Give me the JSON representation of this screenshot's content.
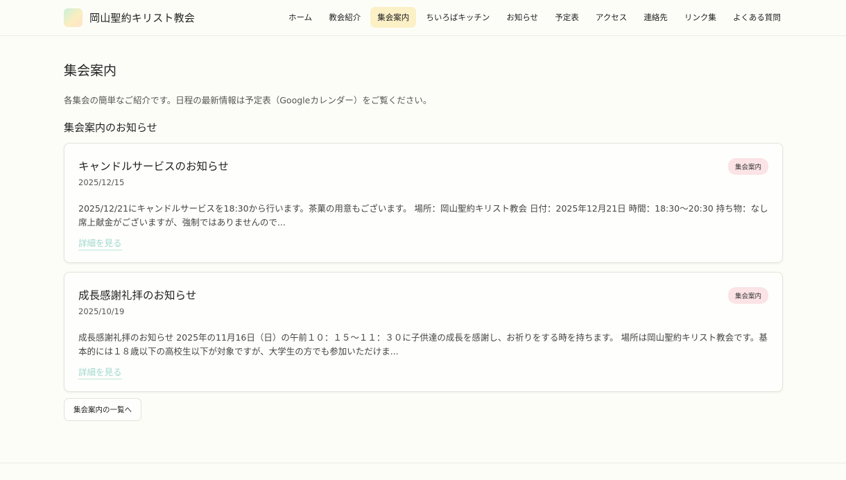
{
  "site": {
    "name": "岡山聖約キリスト教会"
  },
  "nav": {
    "items": [
      {
        "label": "ホーム",
        "active": false
      },
      {
        "label": "教会紹介",
        "active": false
      },
      {
        "label": "集会案内",
        "active": true
      },
      {
        "label": "ちいろばキッチン",
        "active": false
      },
      {
        "label": "お知らせ",
        "active": false
      },
      {
        "label": "予定表",
        "active": false
      },
      {
        "label": "アクセス",
        "active": false
      },
      {
        "label": "連絡先",
        "active": false
      },
      {
        "label": "リンク集",
        "active": false
      },
      {
        "label": "よくある質問",
        "active": false
      }
    ]
  },
  "page": {
    "title": "集会案内",
    "intro": "各集会の簡単なご紹介です。日程の最新情報は予定表（Googleカレンダー）をご覧ください。",
    "section_title": "集会案内のお知らせ"
  },
  "posts": [
    {
      "title": "キャンドルサービスのお知らせ",
      "date": "2025/12/15",
      "category": "集会案内",
      "excerpt": "2025/12/21にキャンドルサービスを18:30から行います。茶菓の用意もございます。 場所：岡山聖約キリスト教会 日付：2025年12月21日 時間：18:30〜20:30 持ち物：なし 席上献金がございますが、強制ではありませんので...",
      "link": "詳細を見る"
    },
    {
      "title": "成長感謝礼拝のお知らせ",
      "date": "2025/10/19",
      "category": "集会案内",
      "excerpt": "成長感謝礼拝のお知らせ 2025年の11月16日（日）の午前１０：１５〜１１：３０に子供達の成長を感謝し、お祈りをする時を持ちます。 場所は岡山聖約キリスト教会です。基本的には１８歳以下の高校生以下が対象ですが、大学生の方でも参加いただけま...",
      "link": "詳細を見る"
    }
  ],
  "list_button": "集会案内の一覧へ",
  "colors": {
    "background": "#fdfdf8",
    "nav_active": "#fcf0c6",
    "badge": "#fbe3e6",
    "link": "#9fd8ce"
  }
}
